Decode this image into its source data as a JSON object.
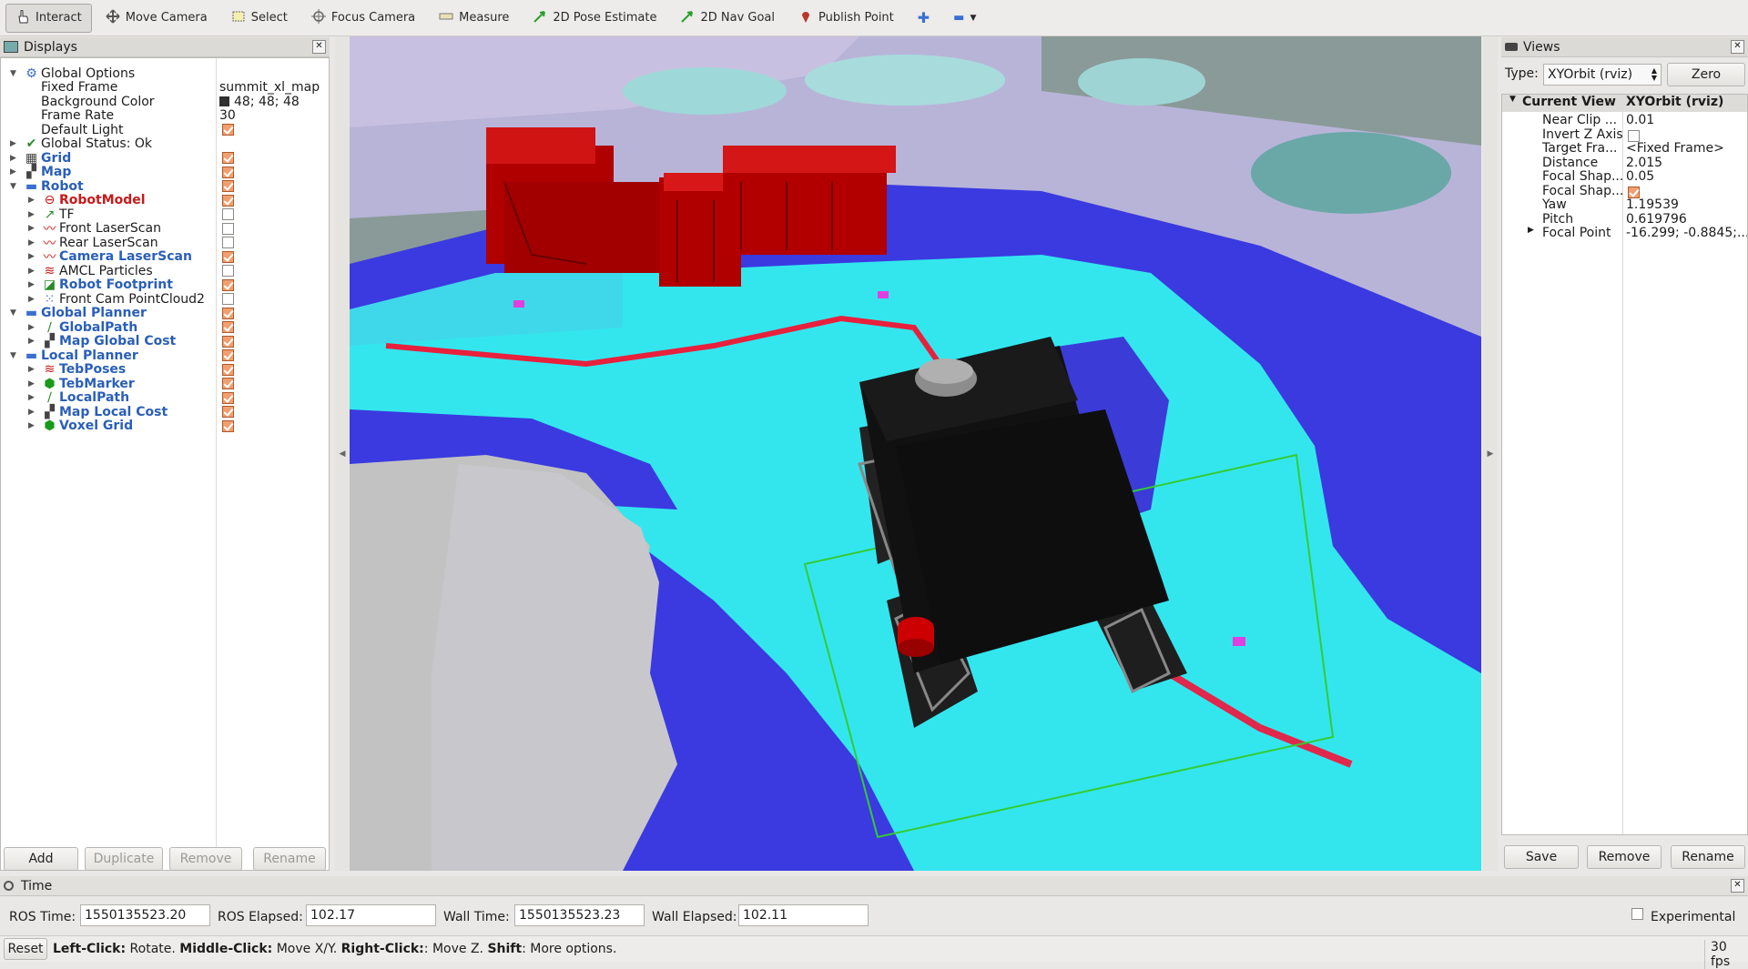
{
  "toolbar": {
    "tools": [
      {
        "label": "Interact",
        "icon": "hand-cursor-icon"
      },
      {
        "label": "Move Camera",
        "icon": "move-camera-icon"
      },
      {
        "label": "Select",
        "icon": "select-box-icon"
      },
      {
        "label": "Focus Camera",
        "icon": "focus-camera-icon"
      },
      {
        "label": "Measure",
        "icon": "ruler-icon"
      },
      {
        "label": "2D Pose Estimate",
        "icon": "green-arrow-icon"
      },
      {
        "label": "2D Nav Goal",
        "icon": "green-arrow-icon"
      },
      {
        "label": "Publish Point",
        "icon": "map-pin-icon"
      }
    ]
  },
  "displays": {
    "title": "Displays",
    "rows": [
      {
        "label": "Global Options",
        "indent": 0,
        "expanded": true,
        "icon": "gear-icon",
        "style": "normal"
      },
      {
        "label": "Fixed Frame",
        "indent": 1,
        "value": "summit_xl_map"
      },
      {
        "label": "Background Color",
        "indent": 1,
        "value": "48; 48; 48",
        "swatch": "#303030"
      },
      {
        "label": "Frame Rate",
        "indent": 1,
        "value": "30"
      },
      {
        "label": "Default Light",
        "indent": 1,
        "check": true
      },
      {
        "label": "Global Status: Ok",
        "indent": 0,
        "collapsed": true,
        "icon": "checkmark-icon",
        "style": "normal"
      },
      {
        "label": "Grid",
        "indent": 0,
        "collapsed": true,
        "icon": "grid-icon",
        "style": "blue",
        "check": true
      },
      {
        "label": "Map",
        "indent": 0,
        "collapsed": true,
        "icon": "map-icon",
        "style": "blue",
        "check": true
      },
      {
        "label": "Robot",
        "indent": 0,
        "expanded": true,
        "icon": "folder-icon",
        "style": "blue",
        "check": true
      },
      {
        "label": "RobotModel",
        "indent": 1,
        "collapsed": true,
        "icon": "error-icon",
        "style": "red",
        "check": true
      },
      {
        "label": "TF",
        "indent": 1,
        "collapsed": true,
        "icon": "tf-axes-icon",
        "style": "normal",
        "check": false
      },
      {
        "label": "Front LaserScan",
        "indent": 1,
        "collapsed": true,
        "icon": "laserscan-icon",
        "style": "normal",
        "check": false
      },
      {
        "label": "Rear LaserScan",
        "indent": 1,
        "collapsed": true,
        "icon": "laserscan-icon",
        "style": "normal",
        "check": false
      },
      {
        "label": "Camera LaserScan",
        "indent": 1,
        "collapsed": true,
        "icon": "laserscan-icon",
        "style": "blue",
        "check": true
      },
      {
        "label": "AMCL Particles",
        "indent": 1,
        "collapsed": true,
        "icon": "pose-array-icon",
        "style": "normal",
        "check": false
      },
      {
        "label": "Robot Footprint",
        "indent": 1,
        "collapsed": true,
        "icon": "polygon-icon",
        "style": "blue",
        "check": true
      },
      {
        "label": "Front Cam PointCloud2",
        "indent": 1,
        "collapsed": true,
        "icon": "pointcloud-icon",
        "style": "normal",
        "check": false
      },
      {
        "label": "Global Planner",
        "indent": 0,
        "expanded": true,
        "icon": "folder-icon",
        "style": "blue",
        "check": true
      },
      {
        "label": "GlobalPath",
        "indent": 1,
        "collapsed": true,
        "icon": "path-icon",
        "style": "blue",
        "check": true
      },
      {
        "label": "Map Global Cost",
        "indent": 1,
        "collapsed": true,
        "icon": "map-icon",
        "style": "blue",
        "check": true
      },
      {
        "label": "Local Planner",
        "indent": 0,
        "expanded": true,
        "icon": "folder-icon",
        "style": "blue",
        "check": true
      },
      {
        "label": "TebPoses",
        "indent": 1,
        "collapsed": true,
        "icon": "pose-array-icon",
        "style": "blue",
        "check": true
      },
      {
        "label": "TebMarker",
        "indent": 1,
        "collapsed": true,
        "icon": "marker-cube-icon",
        "style": "blue",
        "check": true
      },
      {
        "label": "LocalPath",
        "indent": 1,
        "collapsed": true,
        "icon": "path-icon",
        "style": "blue",
        "check": true
      },
      {
        "label": "Map Local Cost",
        "indent": 1,
        "collapsed": true,
        "icon": "map-icon",
        "style": "blue",
        "check": true
      },
      {
        "label": "Voxel Grid",
        "indent": 1,
        "collapsed": true,
        "icon": "marker-cube-icon",
        "style": "blue",
        "check": true
      }
    ],
    "buttons": {
      "add": "Add",
      "duplicate": "Duplicate",
      "remove": "Remove",
      "rename": "Rename"
    }
  },
  "views": {
    "title": "Views",
    "type_label": "Type:",
    "type_value": "XYOrbit (rviz)",
    "zero_label": "Zero",
    "current_view": {
      "key": "Current View",
      "value": "XYOrbit (rviz)"
    },
    "props": [
      {
        "key": "Near Clip ...",
        "value": "0.01"
      },
      {
        "key": "Invert Z Axis",
        "check": false
      },
      {
        "key": "Target Fra...",
        "value": "<Fixed Frame>"
      },
      {
        "key": "Distance",
        "value": "2.015"
      },
      {
        "key": "Focal Shap...",
        "value": "0.05"
      },
      {
        "key": "Focal Shap...",
        "check": true
      },
      {
        "key": "Yaw",
        "value": "1.19539"
      },
      {
        "key": "Pitch",
        "value": "0.619796"
      },
      {
        "key": "Focal Point",
        "value": "-16.299; -0.8845;...",
        "collapsed": true
      }
    ],
    "buttons": {
      "save": "Save",
      "remove": "Remove",
      "rename": "Rename"
    }
  },
  "time": {
    "title": "Time",
    "ros_time_label": "ROS Time:",
    "ros_time": "1550135523.20",
    "ros_elapsed_label": "ROS Elapsed:",
    "ros_elapsed": "102.17",
    "wall_time_label": "Wall Time:",
    "wall_time": "1550135523.23",
    "wall_elapsed_label": "Wall Elapsed:",
    "wall_elapsed": "102.11",
    "experimental_label": "Experimental"
  },
  "status": {
    "reset_label": "Reset",
    "hint_parts": [
      {
        "text": "Left-Click:",
        "bold": true
      },
      {
        "text": " Rotate. ",
        "bold": false
      },
      {
        "text": "Middle-Click:",
        "bold": true
      },
      {
        "text": " Move X/Y. ",
        "bold": false
      },
      {
        "text": "Right-Click:",
        "bold": true
      },
      {
        "text": ": Move Z. ",
        "bold": false
      },
      {
        "text": "Shift",
        "bold": true
      },
      {
        "text": ": More options.",
        "bold": false
      }
    ],
    "fps": "30 fps"
  },
  "colors": {
    "costmap_blue": "#3a3ae0",
    "costmap_cyan": "#33f0f0",
    "costmap_red": "#e8203c",
    "obstacle_red": "#b00000",
    "free_gray": "#bcbcbc",
    "robot_black": "#111111",
    "footprint_green": "#33cc33"
  }
}
